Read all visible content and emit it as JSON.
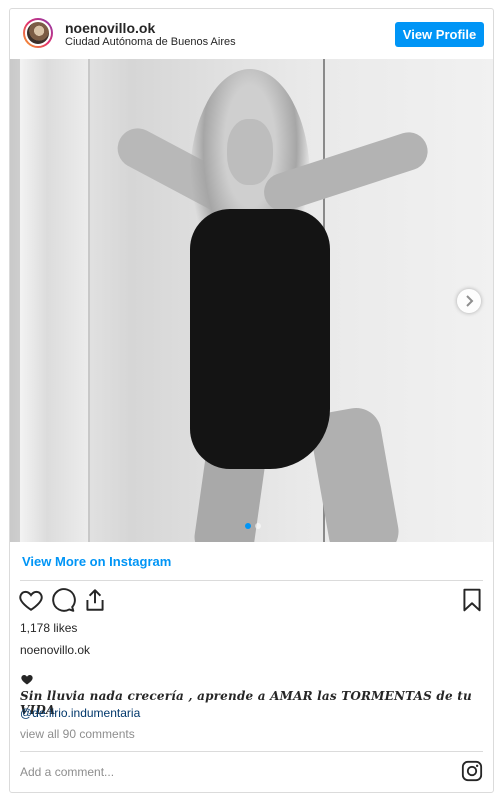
{
  "header": {
    "username": "noenovillo.ok",
    "location": "Ciudad Autónoma de Buenos Aires",
    "view_profile_label": "View Profile"
  },
  "post": {
    "photo_description": "Black and white photo",
    "carousel": {
      "total": 2,
      "current": 1
    },
    "view_more_label": "View More on Instagram",
    "likes": "1,178 likes",
    "author": "noenovillo.ok",
    "caption": "Sin lluvia nada crecería , aprende a AMAR las TORMENTAS de tu VIDA",
    "mention": "@de.lirio.indumentaria",
    "comments_link": "view all 90 comments",
    "add_comment_placeholder": "Add a comment..."
  },
  "icons": {
    "like": "heart-icon",
    "comment": "comment-icon",
    "share": "share-icon",
    "save": "bookmark-icon",
    "brand": "instagram-icon"
  },
  "colors": {
    "accent": "#0095f6",
    "text": "#262626",
    "muted": "#8e8e8e",
    "border": "#dbdbdb",
    "link_dark": "#00376b"
  }
}
